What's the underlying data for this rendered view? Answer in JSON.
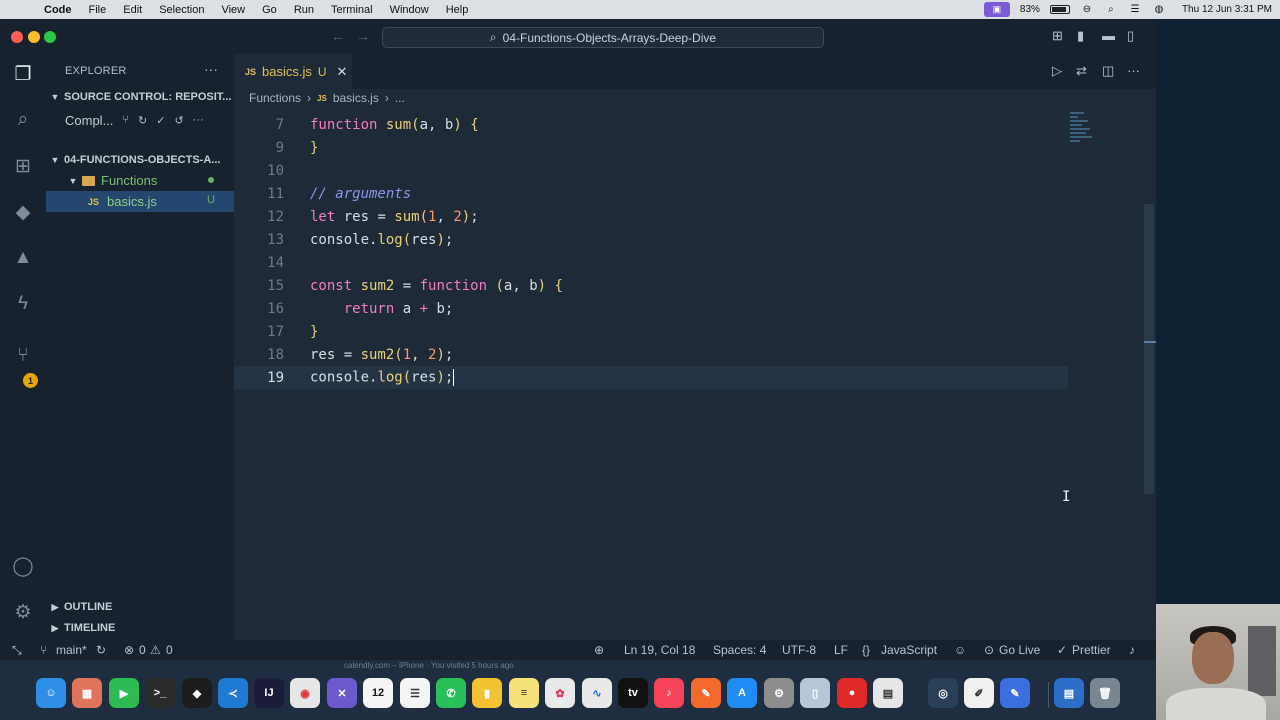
{
  "menubar": {
    "app_name": "Code",
    "items": [
      "File",
      "Edit",
      "Selection",
      "View",
      "Go",
      "Run",
      "Terminal",
      "Window",
      "Help"
    ],
    "battery": "83%",
    "datetime": "Thu 12 Jun  3:31 PM"
  },
  "titlebar": {
    "search_text": "04-Functions-Objects-Arrays-Deep-Dive"
  },
  "sidebar": {
    "header": "EXPLORER",
    "source_control_section": "SOURCE CONTROL: REPOSIT...",
    "commit_label": "Compl...",
    "folder_section": "04-FUNCTIONS-OBJECTS-A...",
    "folder_name": "Functions",
    "file_name": "basics.js",
    "file_status": "U",
    "outline": "OUTLINE",
    "timeline": "TIMELINE"
  },
  "activity": {
    "badge_count": "1"
  },
  "editor": {
    "tab": {
      "icon": "JS",
      "name": "basics.js",
      "status": "U"
    },
    "breadcrumb": {
      "folder": "Functions",
      "file_icon": "JS",
      "file": "basics.js",
      "more": "..."
    }
  },
  "statusbar": {
    "branch": "main*",
    "errors": "0",
    "warnings": "0",
    "position": "Ln 19, Col 18",
    "spaces": "Spaces: 4",
    "encoding": "UTF-8",
    "eol": "LF",
    "language": "JavaScript",
    "go_live": "Go Live",
    "prettier": "Prettier"
  },
  "dock": {
    "note": "calendly.com – iPhone · You visited 5 hours ago",
    "calendar_day": "12"
  },
  "colors": {
    "accent_active_row": "#24476f",
    "keyword": "#f07dc4",
    "function": "#e8d07a",
    "number": "#f49a6c",
    "comment": "#8d96e8"
  }
}
